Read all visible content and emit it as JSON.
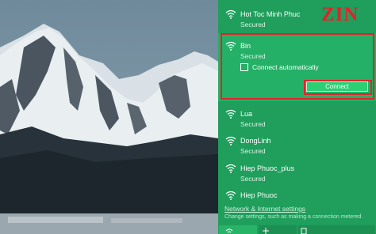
{
  "networks": [
    {
      "ssid": "Hot Toc Minh Phuc",
      "status": "Secured"
    },
    {
      "ssid": "Bin",
      "status": "Secured",
      "selected": true
    },
    {
      "ssid": "Lua",
      "status": "Secured"
    },
    {
      "ssid": "DongLinh",
      "status": "Secured"
    },
    {
      "ssid": "Hiep Phuoc_plus",
      "status": "Secured"
    },
    {
      "ssid": "Hiep Phuoc",
      "status": "Secured"
    }
  ],
  "selected": {
    "connect_automatically_label": "Connect automatically",
    "connect_automatically_checked": false,
    "connect_button_label": "Connect"
  },
  "logo": "ZIN",
  "settings": {
    "link_label": "Network & Internet settings",
    "description": "Change settings, such as making a connection metered."
  },
  "quick_actions": [
    "wifi-icon",
    "airplane-mode-icon",
    "mobile-hotspot-icon"
  ],
  "colors": {
    "flyout_bg": "#1f9e5c",
    "selected_bg": "#24b066",
    "highlight_frame": "#e6202b",
    "logo": "#e6202b"
  }
}
